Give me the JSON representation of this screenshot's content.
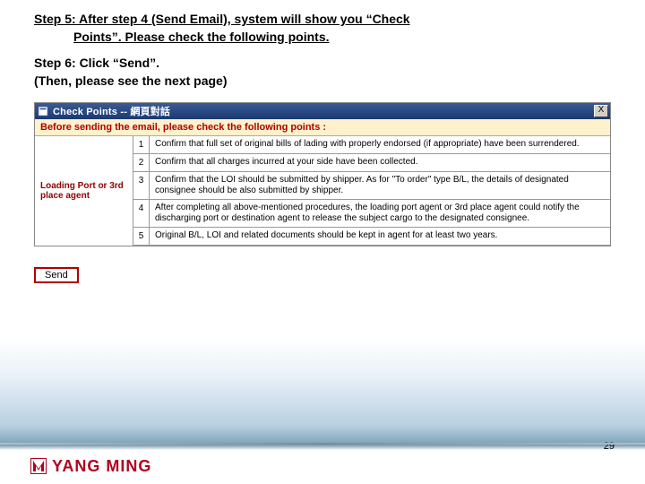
{
  "step5": {
    "line1": "Step 5: After step 4 (Send Email), system will show you “Check",
    "line2": "Points”. Please check the following points."
  },
  "step6": {
    "line1": "Step 6: Click “Send”.",
    "line2": "(Then, please see the next page)"
  },
  "dialog": {
    "title": "Check Points -- 網頁對話",
    "close": "X",
    "header": "Before sending the email, please check the following points :",
    "leftLabel": "Loading Port or 3rd place agent",
    "rows": [
      {
        "n": "1",
        "t": "Confirm that full set of original bills of lading with properly endorsed (if appropriate) have been surrendered."
      },
      {
        "n": "2",
        "t": "Confirm that all charges incurred at your side have been collected."
      },
      {
        "n": "3",
        "t": "Confirm that the LOI should be submitted by shipper. As for \"To order\" type B/L, the details of designated consignee should be also submitted by shipper."
      },
      {
        "n": "4",
        "t": "After completing all above-mentioned procedures, the loading port agent or 3rd place agent could notify the discharging port or destination agent to release the subject cargo to the designated consignee."
      },
      {
        "n": "5",
        "t": "Original B/L, LOI and related documents should be kept in agent for at least two years."
      }
    ]
  },
  "sendLabel": "Send",
  "brand": "YANG MING",
  "pageNumber": "29"
}
